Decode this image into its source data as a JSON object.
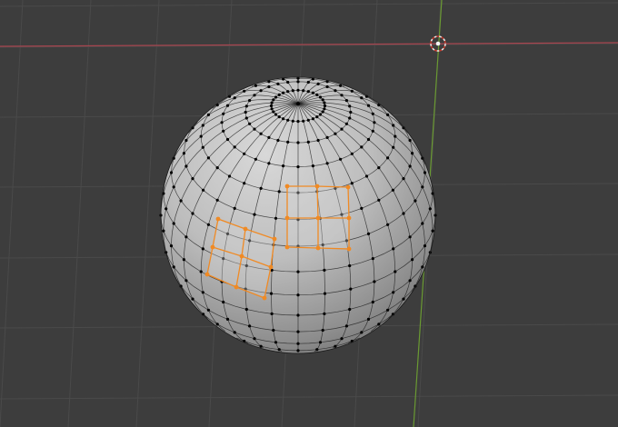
{
  "viewport": {
    "mode": "edit-mode",
    "object": "uv-sphere",
    "selection": "two-face-patches",
    "colors": {
      "background": "#3d3d3d",
      "grid": "#4a4a4a",
      "x_axis": "#a8454f",
      "y_axis": "#6a9a32",
      "mesh_light": "#c9c9c9",
      "mesh_dark": "#6f6f6f",
      "wire": "#1a1a1a",
      "vertex": "#000000",
      "selected": "#f08a24",
      "cursor_ring": "#e8e8e8"
    },
    "icons": {
      "origin": "3d-cursor-icon"
    }
  }
}
